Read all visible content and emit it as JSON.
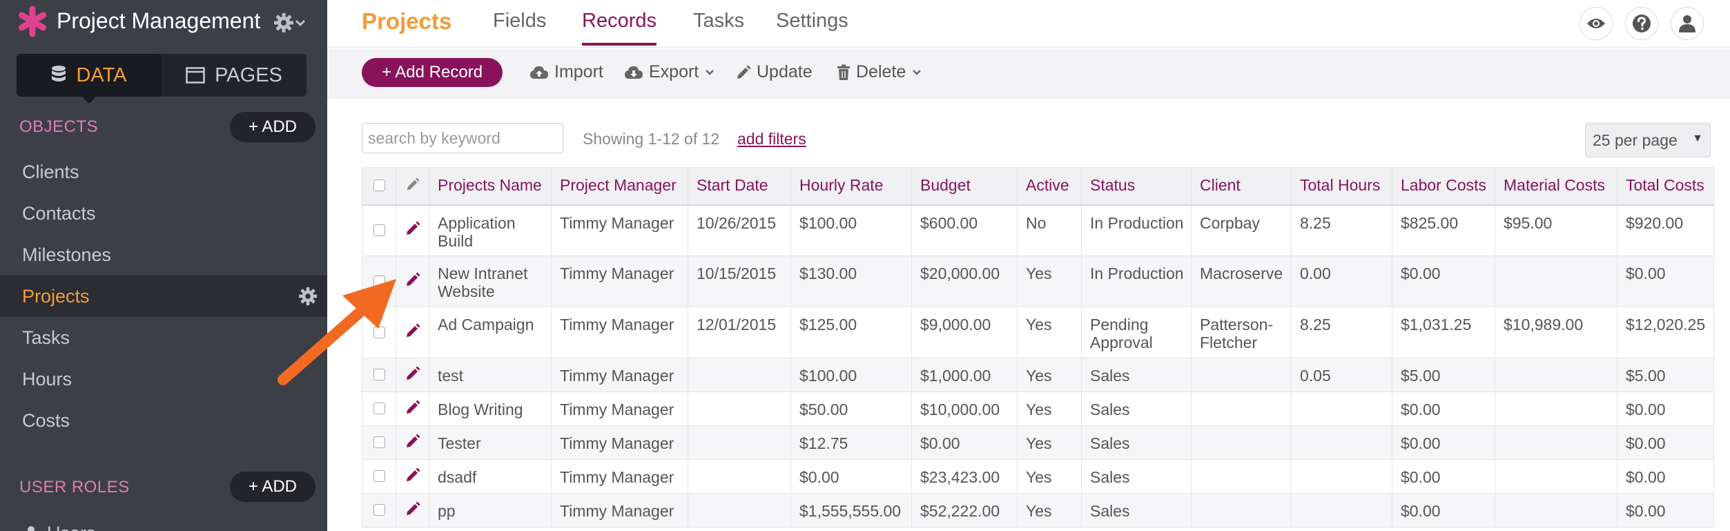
{
  "app": {
    "title": "Project Management",
    "brand_color": "#e0418f",
    "accent_color": "#f29c37",
    "primary_color": "#88135a"
  },
  "sidebar": {
    "mode_data": "DATA",
    "mode_pages": "PAGES",
    "objects_label": "OBJECTS",
    "objects_add": "+ ADD",
    "objects": [
      {
        "label": "Clients"
      },
      {
        "label": "Contacts"
      },
      {
        "label": "Milestones"
      },
      {
        "label": "Projects",
        "active": true
      },
      {
        "label": "Tasks"
      },
      {
        "label": "Hours"
      },
      {
        "label": "Costs"
      }
    ],
    "roles_label": "USER ROLES",
    "roles_add": "+ ADD",
    "roles": [
      {
        "label": "Users"
      }
    ]
  },
  "topnav": {
    "brand": "Projects",
    "tabs": [
      {
        "label": "Fields"
      },
      {
        "label": "Records",
        "active": true
      },
      {
        "label": "Tasks"
      },
      {
        "label": "Settings"
      }
    ],
    "icons": [
      "eye-icon",
      "help-icon",
      "user-icon"
    ]
  },
  "toolbar": {
    "add_record": "+ Add Record",
    "import": "Import",
    "export": "Export",
    "update": "Update",
    "delete": "Delete"
  },
  "filters": {
    "search_placeholder": "search by keyword",
    "showing": "Showing 1-12 of 12",
    "add_filters": "add filters",
    "per_page": "25 per page"
  },
  "table": {
    "columns": [
      "Projects Name",
      "Project Manager",
      "Start Date",
      "Hourly Rate",
      "Budget",
      "Active",
      "Status",
      "Client",
      "Total Hours",
      "Labor Costs",
      "Material Costs",
      "Total Costs"
    ],
    "rows": [
      [
        "Application Build",
        "Timmy Manager",
        "10/26/2015",
        "$100.00",
        "$600.00",
        "No",
        "In Production",
        "Corpbay",
        "8.25",
        "$825.00",
        "$95.00",
        "$920.00"
      ],
      [
        "New Intranet Website",
        "Timmy Manager",
        "10/15/2015",
        "$130.00",
        "$20,000.00",
        "Yes",
        "In Production",
        "Macroserve",
        "0.00",
        "$0.00",
        "",
        "$0.00"
      ],
      [
        "Ad Campaign",
        "Timmy Manager",
        "12/01/2015",
        "$125.00",
        "$9,000.00",
        "Yes",
        "Pending Approval",
        "Patterson-Fletcher",
        "8.25",
        "$1,031.25",
        "$10,989.00",
        "$12,020.25"
      ],
      [
        "test",
        "Timmy Manager",
        "",
        "$100.00",
        "$1,000.00",
        "Yes",
        "Sales",
        "",
        "0.05",
        "$5.00",
        "",
        "$5.00"
      ],
      [
        "Blog Writing",
        "Timmy Manager",
        "",
        "$50.00",
        "$10,000.00",
        "Yes",
        "Sales",
        "",
        "",
        "$0.00",
        "",
        "$0.00"
      ],
      [
        "Tester",
        "Timmy Manager",
        "",
        "$12.75",
        "$0.00",
        "Yes",
        "Sales",
        "",
        "",
        "$0.00",
        "",
        "$0.00"
      ],
      [
        "dsadf",
        "Timmy Manager",
        "",
        "$0.00",
        "$23,423.00",
        "Yes",
        "Sales",
        "",
        "",
        "$0.00",
        "",
        "$0.00"
      ],
      [
        "pp",
        "Timmy Manager",
        "",
        "$1,555,555.00",
        "$52,222.00",
        "Yes",
        "Sales",
        "",
        "",
        "$0.00",
        "",
        "$0.00"
      ]
    ]
  }
}
